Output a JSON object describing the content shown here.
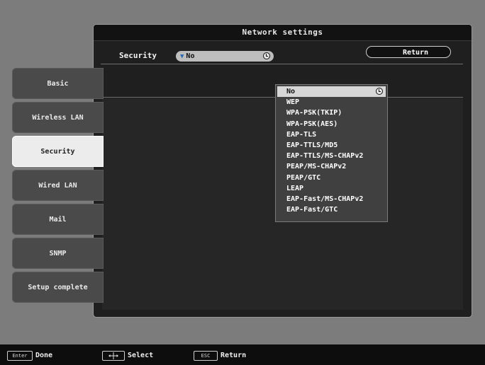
{
  "window": {
    "title": "Network settings",
    "return_label": "Return"
  },
  "sidebar": {
    "items": [
      {
        "label": "Basic"
      },
      {
        "label": "Wireless LAN"
      },
      {
        "label": "Security"
      },
      {
        "label": "Wired LAN"
      },
      {
        "label": "Mail"
      },
      {
        "label": "SNMP"
      },
      {
        "label": "Setup complete"
      }
    ],
    "active": "Security"
  },
  "form": {
    "security_label": "Security",
    "security_value": "No",
    "options": [
      "No",
      "WEP",
      "WPA-PSK(TKIP)",
      "WPA-PSK(AES)",
      "EAP-TLS",
      "EAP-TTLS/MD5",
      "EAP-TTLS/MS-CHAPv2",
      "PEAP/MS-CHAPv2",
      "PEAP/GTC",
      "LEAP",
      "EAP-Fast/MS-CHAPv2",
      "EAP-Fast/GTC"
    ]
  },
  "footer": {
    "enter_key": "Enter",
    "enter_label": "Done",
    "select_label": "Select",
    "esc_key": "ESC",
    "esc_label": "Return"
  },
  "colors": {
    "background": "#7c7c7c",
    "window": "#1f1f1f",
    "active_tab": "#ececec",
    "dropdown": "#404040"
  }
}
